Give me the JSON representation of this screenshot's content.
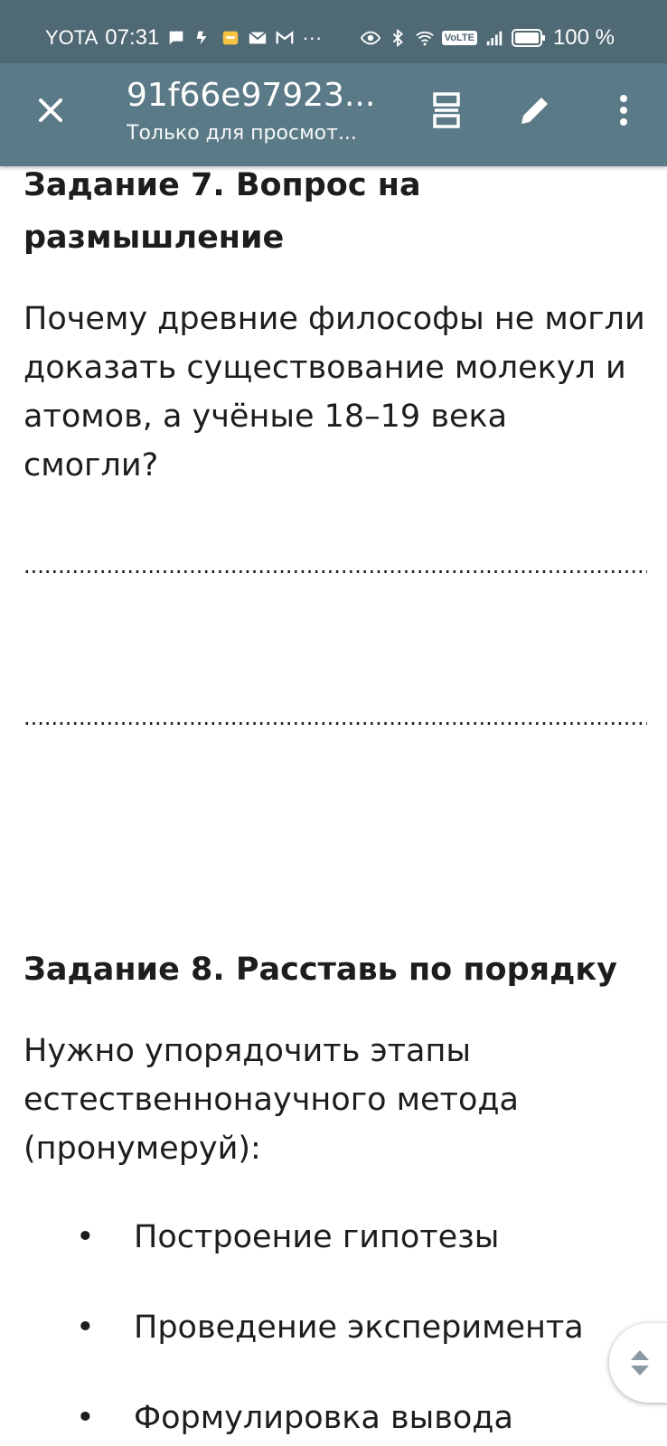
{
  "status_bar": {
    "carrier": "YOTA",
    "time": "07:31",
    "more": "···",
    "volte": "VoLTE",
    "battery": "100 %"
  },
  "app_bar": {
    "title": "91f66e97923...",
    "subtitle": "Только для просмот..."
  },
  "content": {
    "task7": {
      "heading": "Задание 7. Вопрос на размышление",
      "question": "Почему древние философы не могли доказать существование молекул и атомов, а учёные 18–19 века смогли?",
      "answer_lines": [
        "........................................................................................................................................................................................................................................................................................................................",
        "........................................................................................................................................................................................................................................................................................................................"
      ]
    },
    "task8": {
      "heading": "Задание 8. Расставь по порядку",
      "intro": "Нужно упорядочить этапы естественнонаучного метода (пронумеруй):",
      "items": [
        "Построение гипотезы",
        "Проведение эксперимента",
        "Формулировка вывода"
      ]
    }
  },
  "icons": {
    "close": "close-icon",
    "reflow": "reflow-icon",
    "edit": "pencil-icon",
    "menu": "more-vert-icon",
    "scroll": "scroll-handle-icon"
  },
  "colors": {
    "status_bar": "#4f6975",
    "app_bar": "#5b7a87",
    "text": "#1d1d1d"
  }
}
